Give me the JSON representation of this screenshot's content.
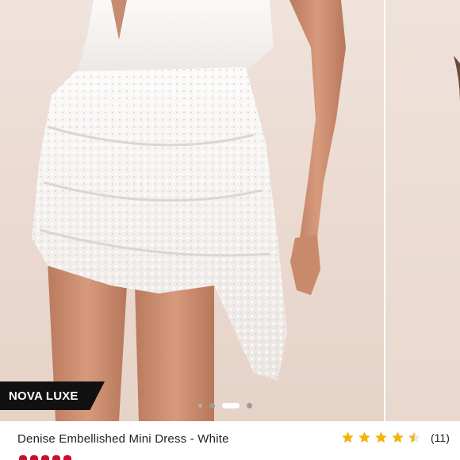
{
  "product": {
    "brand": "NOVA LUXE",
    "title": "Denise Embellished Mini Dress - White",
    "rating_value": 4.5,
    "rating_max": 5,
    "review_count": "(11)"
  },
  "gallery": {
    "slide_count": 4,
    "active_index": 2
  },
  "colors": {
    "star": "#f2b50f",
    "badge_bg": "#111111",
    "price": "#c8102e",
    "backdrop": "#ead9cf",
    "dress": "#f7f4f2"
  },
  "icons": [
    "star-icon",
    "half-star-icon"
  ]
}
